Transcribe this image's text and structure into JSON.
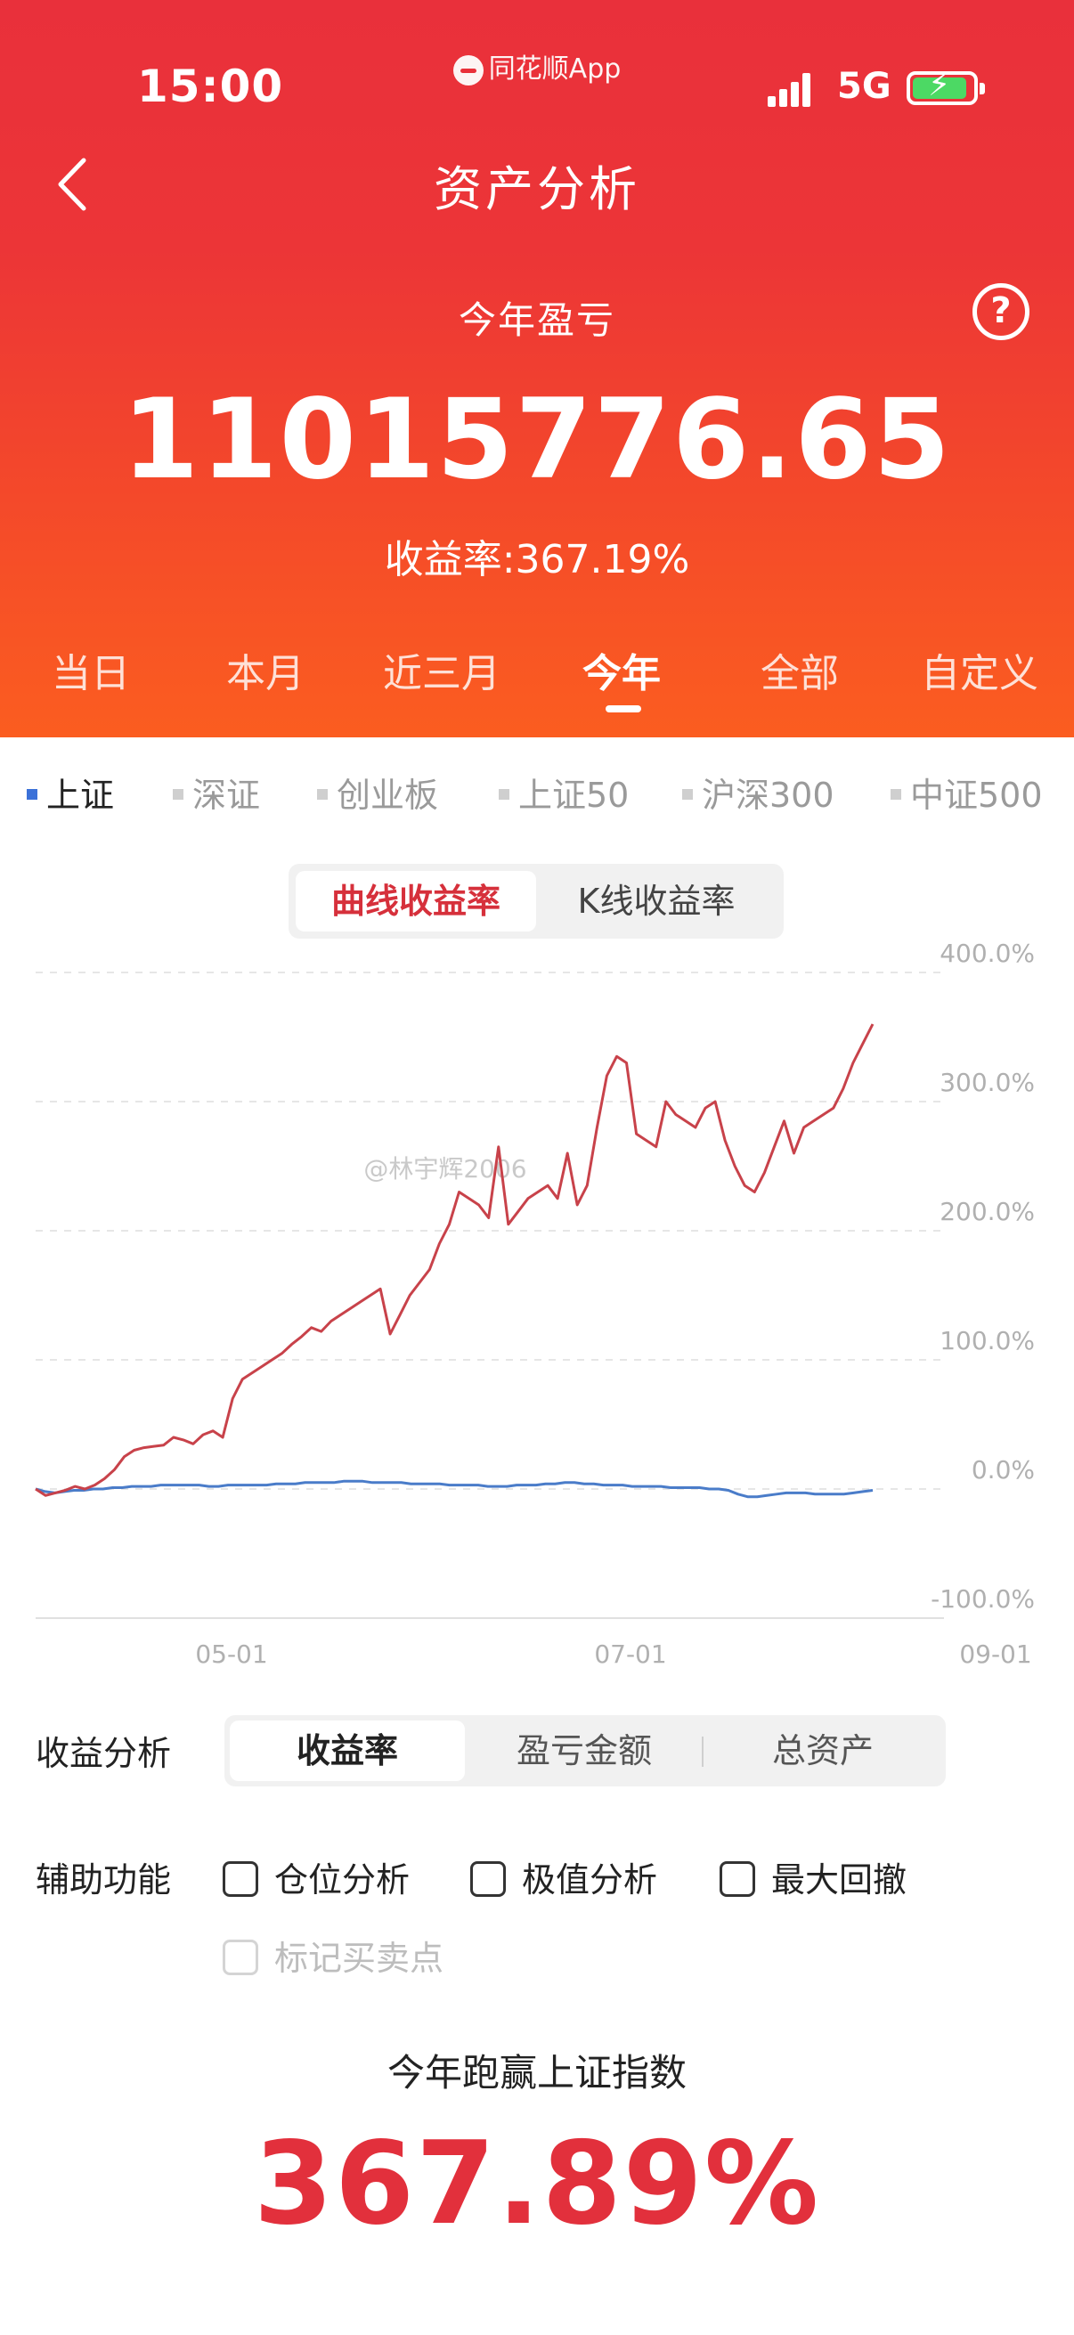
{
  "status_bar": {
    "time": "15:00",
    "carrier_app": "同花顺App",
    "network": "5G"
  },
  "header": {
    "title": "资产分析",
    "year_label": "今年盈亏",
    "amount": "11015776.65",
    "rate_text": "收益率:367.19%"
  },
  "period_tabs": [
    {
      "label": "当日"
    },
    {
      "label": "本月"
    },
    {
      "label": "近三月"
    },
    {
      "label": "今年",
      "active": true
    },
    {
      "label": "全部"
    },
    {
      "label": "自定义"
    }
  ],
  "index_tabs": [
    {
      "label": "上证",
      "active": true
    },
    {
      "label": "深证"
    },
    {
      "label": "创业板"
    },
    {
      "label": "上证50"
    },
    {
      "label": "沪深300"
    },
    {
      "label": "中证500"
    }
  ],
  "chart_mode": {
    "curve": "曲线收益率",
    "kline": "K线收益率"
  },
  "chart_data": {
    "type": "line",
    "x_ticks": [
      "05-01",
      "07-01",
      "09-01"
    ],
    "y_ticks": [
      "400.0%",
      "300.0%",
      "200.0%",
      "100.0%",
      "0.0%",
      "-100.0%"
    ],
    "ylim": [
      -100,
      400
    ],
    "grid": true,
    "watermark": "@林宇辉2006",
    "colors": {
      "portfolio": "#c8424a",
      "index": "#4a7cc9"
    },
    "series": [
      {
        "values": [
          0,
          -5,
          -3,
          -1,
          2,
          0,
          3,
          8,
          15,
          25,
          30,
          32,
          33,
          34,
          40,
          38,
          35,
          42,
          45,
          40,
          70,
          85,
          90,
          95,
          100,
          105,
          112,
          118,
          125,
          122,
          130,
          135,
          140,
          145,
          150,
          155,
          120,
          135,
          150,
          160,
          170,
          190,
          205,
          230,
          225,
          220,
          210,
          265,
          205,
          215,
          225,
          230,
          235,
          225,
          260,
          220,
          235,
          280,
          320,
          335,
          330,
          275,
          270,
          265,
          300,
          290,
          285,
          280,
          295,
          300,
          270,
          250,
          235,
          230,
          245,
          265,
          285,
          260,
          280,
          285,
          290,
          295,
          310,
          330,
          345,
          360
        ]
      },
      {
        "values": [
          0,
          -2,
          -3,
          -2,
          -1,
          -1,
          0,
          0,
          1,
          1,
          2,
          2,
          2,
          3,
          3,
          3,
          3,
          3,
          2,
          2,
          3,
          3,
          3,
          3,
          3,
          4,
          4,
          4,
          5,
          5,
          5,
          5,
          6,
          6,
          6,
          5,
          5,
          5,
          5,
          4,
          4,
          4,
          4,
          3,
          3,
          3,
          3,
          2,
          2,
          2,
          3,
          3,
          3,
          4,
          4,
          5,
          5,
          4,
          4,
          3,
          3,
          3,
          2,
          2,
          2,
          2,
          1,
          1,
          1,
          1,
          0,
          0,
          -1,
          -4,
          -6,
          -6,
          -5,
          -4,
          -3,
          -3,
          -3,
          -4,
          -4,
          -4,
          -4,
          -3,
          -2,
          -1
        ]
      }
    ]
  },
  "analysis": {
    "label": "收益分析",
    "tabs": [
      {
        "label": "收益率",
        "active": true
      },
      {
        "label": "盈亏金额"
      },
      {
        "label": "总资产"
      }
    ]
  },
  "aux": {
    "label": "辅助功能",
    "options": [
      {
        "label": "仓位分析"
      },
      {
        "label": "极值分析"
      },
      {
        "label": "最大回撤"
      },
      {
        "label": "标记买卖点",
        "disabled": true
      }
    ]
  },
  "beat": {
    "label": "今年跑赢上证指数",
    "value": "367.89%"
  },
  "icons": {
    "back": "chevron-left-icon",
    "help": "question-circle-icon",
    "signal": "signal-icon",
    "battery": "battery-charging-icon",
    "logo": "tonghuashun-logo-icon",
    "checkbox": "checkbox-unchecked-icon"
  }
}
